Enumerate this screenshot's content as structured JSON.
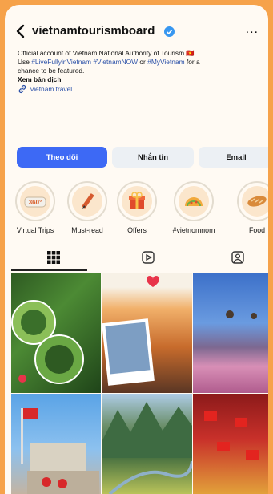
{
  "header": {
    "username": "vietnamtourismboard",
    "more_label": "..."
  },
  "bio": {
    "line1": "Official account of Vietnam National Authority of Tourism 🇻🇳",
    "line2_pre": "Use ",
    "line2_tags": "#LiveFullyinVietnam #VietnamNOW",
    "line2_mid": " or ",
    "line2_tag2": "#MyVietnam",
    "line2_post": " for a",
    "line3": "chance to be featured.",
    "translate": "Xem bản dịch",
    "link": "vietnam.travel"
  },
  "buttons": {
    "follow": "Theo dõi",
    "message": "Nhắn tin",
    "email": "Email"
  },
  "highlights": [
    {
      "label": "Virtual Trips",
      "icon": "vr-360-icon"
    },
    {
      "label": "Must-read",
      "icon": "pen-icon"
    },
    {
      "label": "Offers",
      "icon": "gift-icon"
    },
    {
      "label": "#vietnomnom",
      "icon": "banh-xeo-icon"
    },
    {
      "label": "Food",
      "icon": "bread-icon"
    }
  ],
  "tabs": [
    "grid-icon",
    "reels-icon",
    "tagged-icon"
  ],
  "colors": {
    "accent": "#3d69f5",
    "frame": "#f6a24a",
    "verified": "#3897f0"
  }
}
